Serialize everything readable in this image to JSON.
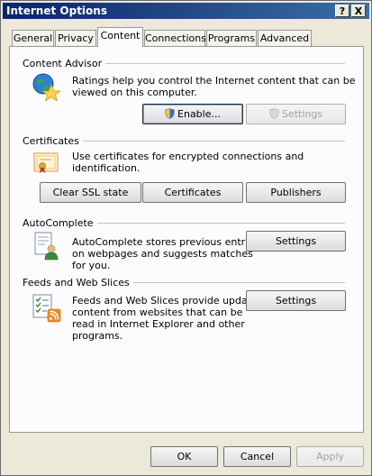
{
  "window": {
    "title": "Internet Options",
    "help_label": "?",
    "close_label": "X"
  },
  "tabs": [
    {
      "label": "General"
    },
    {
      "label": "Privacy"
    },
    {
      "label": "Content",
      "active": true
    },
    {
      "label": "Connections"
    },
    {
      "label": "Programs"
    },
    {
      "label": "Advanced"
    }
  ],
  "content_advisor": {
    "title": "Content Advisor",
    "description_line1": "Ratings help you control the Internet content that can be",
    "description_line2": "viewed on this computer.",
    "enable_label": "Enable...",
    "settings_label": "Settings",
    "icon": "globe-star-icon"
  },
  "certificates": {
    "title": "Certificates",
    "description": "Use certificates for encrypted connections and identification.",
    "clear_ssl_label": "Clear SSL state",
    "certificates_label": "Certificates",
    "publishers_label": "Publishers",
    "icon": "certificate-icon"
  },
  "autocomplete": {
    "title": "AutoComplete",
    "description_line1": "AutoComplete stores previous entries",
    "description_line2": "on webpages and suggests matches",
    "description_line3": "for you.",
    "settings_label": "Settings",
    "icon": "autocomplete-icon"
  },
  "feeds": {
    "title": "Feeds and Web Slices",
    "description_line1": "Feeds and Web Slices provide updated",
    "description_line2": "content from websites that can be",
    "description_line3": "read in Internet Explorer and other",
    "description_line4": "programs.",
    "settings_label": "Settings",
    "icon": "rss-feed-icon"
  },
  "footer": {
    "ok_label": "OK",
    "cancel_label": "Cancel",
    "apply_label": "Apply"
  },
  "colors": {
    "titlebar_start": "#0a246a",
    "titlebar_end": "#3a6ea5",
    "dialog_bg": "#ece9d8",
    "panel_bg": "#fcfcfe"
  }
}
